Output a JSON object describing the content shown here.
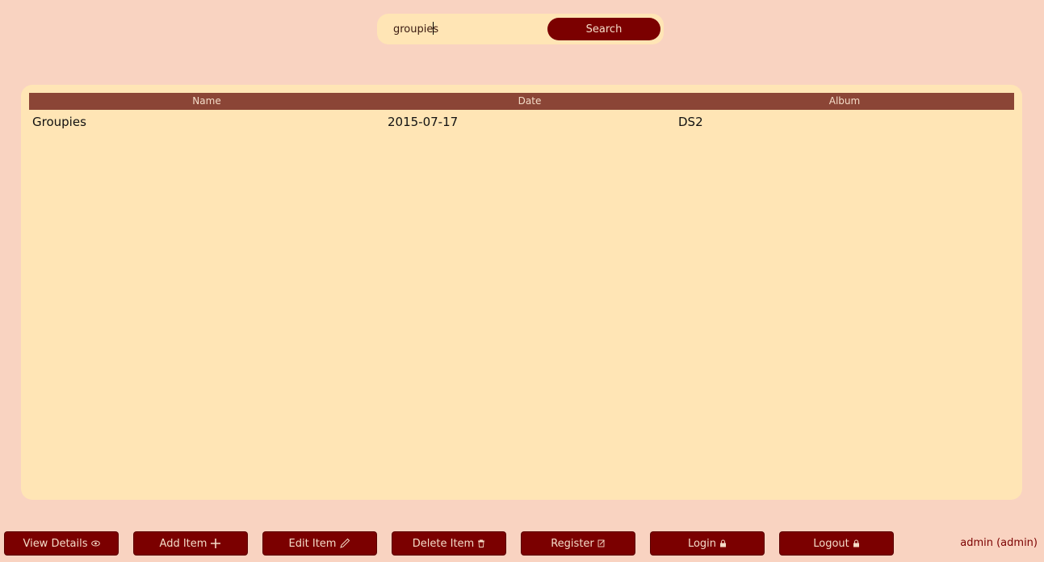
{
  "search": {
    "value": "groupies",
    "button_label": "Search"
  },
  "table": {
    "columns": [
      "Name",
      "Date",
      "Album"
    ],
    "rows": [
      {
        "name": "Groupies",
        "date": "2015-07-17",
        "album": "DS2"
      }
    ]
  },
  "toolbar": {
    "view_details": "View Details",
    "add_item": "Add Item",
    "edit_item": "Edit Item",
    "delete_item": "Delete Item",
    "register": "Register",
    "login": "Login",
    "logout": "Logout"
  },
  "user": {
    "label": "admin (admin)"
  },
  "colors": {
    "background": "#f9d3c1",
    "panel": "#ffe5b5",
    "accent": "#7b0000",
    "header": "#8b4536"
  },
  "icons": {
    "view_details": "eye-icon",
    "add_item": "plus-icon",
    "edit_item": "pencil-icon",
    "delete_item": "trash-icon",
    "register": "register-icon",
    "login": "lock-icon",
    "logout": "lock-icon"
  }
}
